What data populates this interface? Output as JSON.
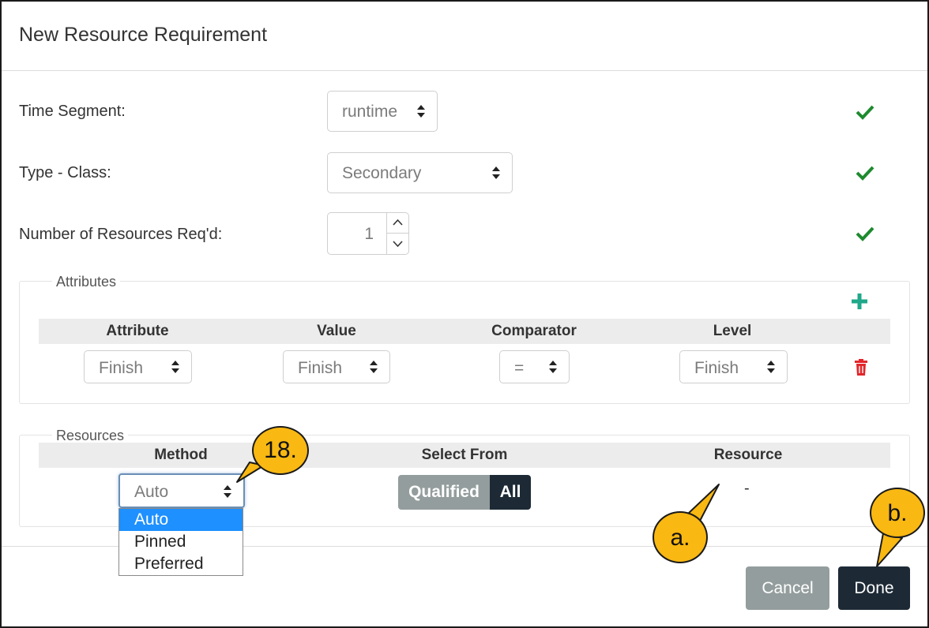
{
  "dialog": {
    "title": "New Resource Requirement"
  },
  "fields": {
    "time_segment": {
      "label": "Time Segment:",
      "value": "runtime"
    },
    "type_class": {
      "label": "Type - Class:",
      "value": "Secondary"
    },
    "num_resources": {
      "label": "Number of Resources Req'd:",
      "value": "1"
    }
  },
  "attributes": {
    "legend": "Attributes",
    "headers": [
      "Attribute",
      "Value",
      "Comparator",
      "Level"
    ],
    "row": {
      "attribute": "Finish",
      "value": "Finish",
      "comparator": "=",
      "level": "Finish"
    }
  },
  "resources": {
    "legend": "Resources",
    "headers": [
      "Method",
      "Select From",
      "Resource"
    ],
    "method_value": "Auto",
    "method_options": [
      "Auto",
      "Pinned",
      "Preferred"
    ],
    "select_from": {
      "qualified": "Qualified",
      "all": "All"
    },
    "resource_value": "-"
  },
  "footer": {
    "cancel": "Cancel",
    "done": "Done"
  },
  "callouts": {
    "c18": "18.",
    "ca": "a.",
    "cb": "b."
  },
  "colors": {
    "check": "#1e8a2e",
    "plus": "#1fa889",
    "trash": "#e2262b",
    "done_bg": "#1d2a36",
    "cancel_bg": "#949d9d",
    "callout": "#f9b812",
    "highlight": "#1e90ff"
  }
}
